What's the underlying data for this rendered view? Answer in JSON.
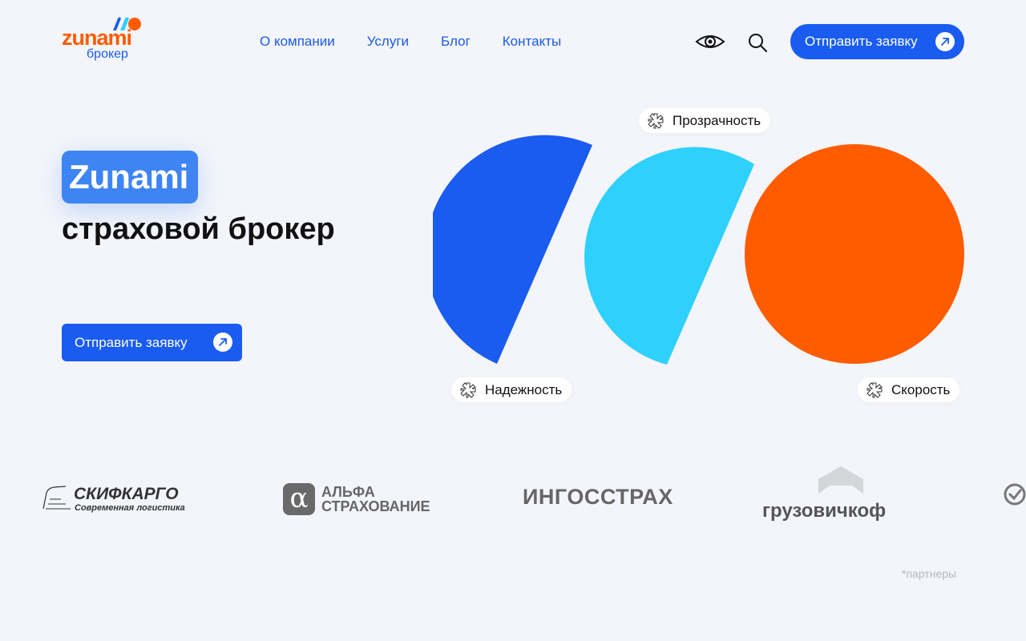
{
  "header": {
    "logo": {
      "word": "zunami",
      "sub": "брокер"
    },
    "nav": [
      "О компании",
      "Услуги",
      "Блог",
      "Контакты"
    ],
    "icons": {
      "accessibility": "eye-icon",
      "search": "search-icon"
    },
    "cta_label": "Отправить заявку"
  },
  "hero": {
    "badge": "Zunami",
    "headline": "страховой брокер",
    "cta_label": "Отправить заявку",
    "tags": {
      "transparency": "Прозрачность",
      "reliability": "Надежность",
      "speed": "Скорость"
    }
  },
  "partners": {
    "skif": {
      "name": "СКИФКАРГО",
      "tagline": "Современная логистика"
    },
    "alfa": {
      "mark": "α",
      "line1": "АЛЬФА",
      "line2": "СТРАХОВАНИЕ"
    },
    "ingo": "ИНГОССТРАХ",
    "gruz": "грузовичкоф",
    "note": "*партнеры"
  },
  "colors": {
    "primary_blue": "#1a5cf0",
    "cyan": "#2ed0fc",
    "orange": "#ff5c00",
    "badge_blue": "#3f84f3",
    "background": "#f3f5fa"
  }
}
